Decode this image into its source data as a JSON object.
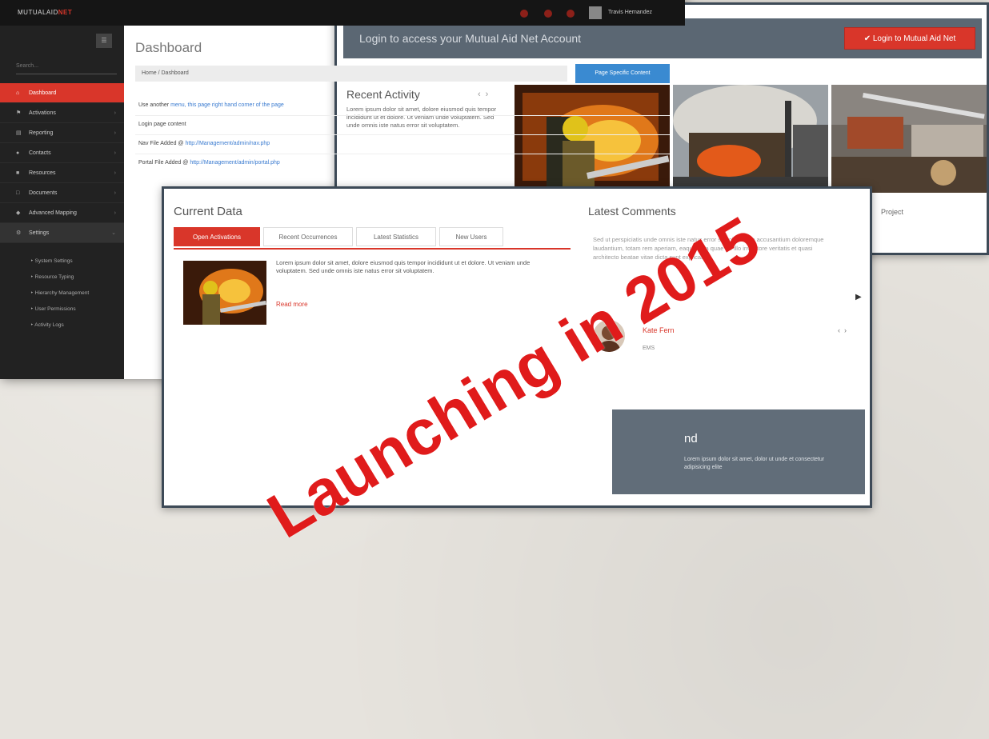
{
  "colors": {
    "accent_red": "#d9362a",
    "dark_slate": "#5b6773",
    "sidebar_dark": "#222222",
    "link_blue": "#3a8ad1",
    "overlay_red": "#e01b1b"
  },
  "screen_login": {
    "banner_text": "Login to access your Mutual Aid Net Account",
    "login_button": "Login to Mutual Aid Net",
    "login_icon": "check-icon",
    "recent_activity_title": "Recent Activity",
    "recent_activity_text": "Lorem ipsum dolor sit amet, dolore eiusmod quis tempor incididunt ut et dolore. Ut veniam unde voluptatem. Sed unde omnis iste natus error sit voluptatem.",
    "photo_caption": "Project"
  },
  "screen_data": {
    "heading": "Current Data",
    "tabs": [
      "Open Activations",
      "Recent Occurrences",
      "Latest Statistics",
      "New Users"
    ],
    "body_text": "Lorem ipsum dolor sit amet, dolore eiusmod quis tempor incididunt ut et dolore. Ut veniam unde voluptatem. Sed unde omnis iste natus error sit voluptatem.",
    "read_more": "Read more",
    "comments_title": "Latest Comments",
    "comments_text": "Sed ut perspiciatis unde omnis iste natus error sit voluptatem accusantium doloremque laudantium, totam rem aperiam, eaque ipsa quae ab illo inventore veritatis et quasi architecto beatae vitae dicta sunt explicabo.",
    "commenter_name": "Kate Fern",
    "commenter_role": "EMS",
    "dark_title": "nd",
    "dark_text": "Lorem ipsum dolor sit amet, dolor ut unde et consectetur adipisicing elite"
  },
  "screen_dashboard": {
    "logo_text": "MUTUALAID",
    "logo_accent": "NET",
    "user_name": "Travis Hernandez",
    "search_placeholder": "Search...",
    "collapse_icon": "menu-icon",
    "nav": [
      {
        "label": "Dashboard",
        "icon": "home-icon"
      },
      {
        "label": "Activations",
        "icon": "flag-icon"
      },
      {
        "label": "Reporting",
        "icon": "chart-icon"
      },
      {
        "label": "Contacts",
        "icon": "user-icon"
      },
      {
        "label": "Resources",
        "icon": "truck-icon"
      },
      {
        "label": "Documents",
        "icon": "document-icon"
      },
      {
        "label": "Advanced Mapping",
        "icon": "map-icon"
      },
      {
        "label": "Settings",
        "icon": "gear-icon"
      }
    ],
    "settings_sub": [
      "System Settings",
      "Resource Typing",
      "Hierarchy Management",
      "User Permissions",
      "Activity Logs"
    ],
    "page_title": "Dashboard",
    "breadcrumb": "Home / Dashboard",
    "page_button": "Page Specific Content",
    "rows": [
      {
        "prefix": "Use another ",
        "link": "menu, this page right hand corner of the page",
        "suffix": ""
      },
      {
        "prefix": "Login page content",
        "link": "",
        "suffix": ""
      },
      {
        "prefix": "Nav File Added @ ",
        "link": "http://Management/admin/nav.php",
        "suffix": ""
      },
      {
        "prefix": "Portal File Added @ ",
        "link": "http://Management/admin/portal.php",
        "suffix": ""
      }
    ]
  },
  "overlay_text": "Launching in 2015"
}
